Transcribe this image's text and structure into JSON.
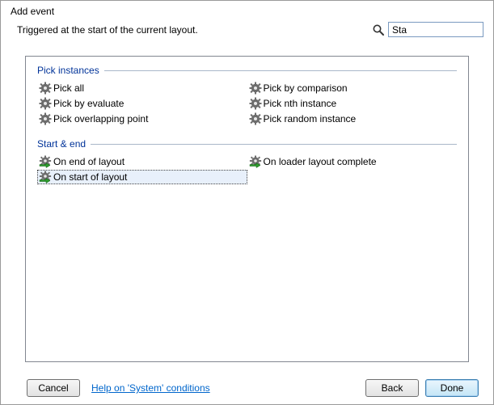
{
  "window": {
    "title": "Add event",
    "description": "Triggered at the start of the current layout."
  },
  "search": {
    "value": "Sta",
    "placeholder": ""
  },
  "groups": [
    {
      "id": "pick-instances",
      "title": "Pick instances",
      "icon": "gear",
      "columns": [
        [
          {
            "id": "pick-all",
            "label": "Pick all",
            "selected": false
          },
          {
            "id": "pick-by-evaluate",
            "label": "Pick by evaluate",
            "selected": false
          },
          {
            "id": "pick-overlapping-point",
            "label": "Pick overlapping point",
            "selected": false
          }
        ],
        [
          {
            "id": "pick-by-comparison",
            "label": "Pick by comparison",
            "selected": false
          },
          {
            "id": "pick-nth-instance",
            "label": "Pick nth instance",
            "selected": false
          },
          {
            "id": "pick-random-instance",
            "label": "Pick random instance",
            "selected": false
          }
        ]
      ]
    },
    {
      "id": "start-end",
      "title": "Start & end",
      "icon": "gear-arrow",
      "columns": [
        [
          {
            "id": "on-end-of-layout",
            "label": "On end of layout",
            "selected": false
          },
          {
            "id": "on-start-of-layout",
            "label": "On start of layout",
            "selected": true
          }
        ],
        [
          {
            "id": "on-loader-layout-complete",
            "label": "On loader layout complete",
            "selected": false
          }
        ]
      ]
    }
  ],
  "footer": {
    "cancel": "Cancel",
    "help": "Help on 'System' conditions",
    "back": "Back",
    "done": "Done"
  }
}
